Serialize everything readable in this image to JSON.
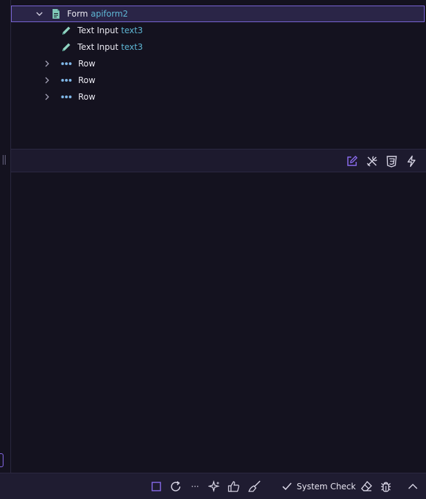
{
  "tree": {
    "rows": [
      {
        "label": "Form",
        "id": "apiform2"
      },
      {
        "label": "Text Input",
        "id": "text3"
      },
      {
        "label": "Text Input",
        "id": "text3"
      },
      {
        "label": "Row"
      },
      {
        "label": "Row"
      },
      {
        "label": "Row"
      }
    ]
  },
  "toolbar": {
    "icons": [
      "edit-icon",
      "tools-icon",
      "css3-icon",
      "lightning-icon"
    ],
    "accent": "#8b6cf0"
  },
  "status_bar": {
    "system_check_label": "System Check",
    "more_label": "···"
  },
  "colors": {
    "background": "#14121f",
    "selection": "#2a2547",
    "id_text": "#5fb8d6",
    "form_icon": "#7fc8b8"
  }
}
